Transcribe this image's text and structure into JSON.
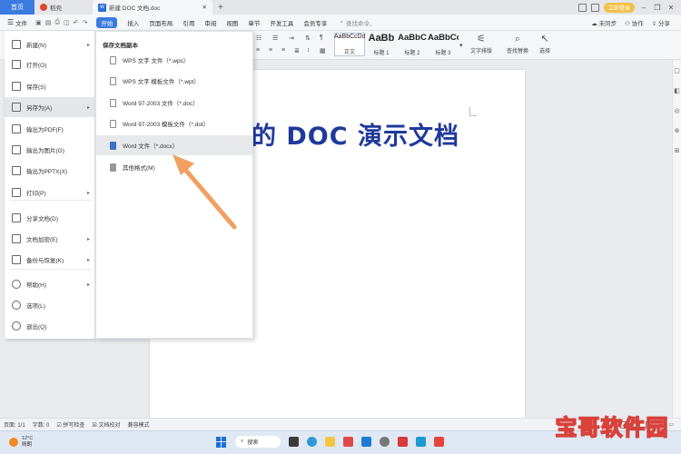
{
  "tabs": {
    "home": "首页",
    "dao": "稻壳",
    "doc_title": "新建 DOC 文档.doc",
    "login_label": "立即登录"
  },
  "menubar": {
    "file_label": "文件",
    "ribbon_tabs": [
      "开始",
      "插入",
      "页面布局",
      "引用",
      "审阅",
      "视图",
      "章节",
      "开发工具",
      "会员专享"
    ],
    "search_placeholder": "查找命令、",
    "unsync": "未同步",
    "collab": "协作",
    "share": "分享"
  },
  "toolbar": {
    "styles": [
      {
        "sample": "AaBbCcDd",
        "caption": "正文"
      },
      {
        "sample": "AaBb",
        "caption": "标题 1"
      },
      {
        "sample": "AaBbC",
        "caption": "标题 2"
      },
      {
        "sample": "AaBbCc",
        "caption": "标题 3"
      }
    ],
    "tools": [
      {
        "label": "文字排版",
        "icon": "text-layout-icon"
      },
      {
        "label": "查找替换",
        "icon": "find-replace-icon"
      },
      {
        "label": "选择",
        "icon": "select-cursor-icon"
      }
    ]
  },
  "file_menu": {
    "items": [
      {
        "label": "新建(N)",
        "icon": "new-doc-icon",
        "has_arrow": true
      },
      {
        "label": "打开(O)",
        "icon": "open-folder-icon",
        "has_arrow": false
      },
      {
        "label": "保存(S)",
        "icon": "save-icon",
        "has_arrow": false
      },
      {
        "label": "另存为(A)",
        "icon": "save-as-icon",
        "has_arrow": true
      },
      {
        "label": "输出为PDF(F)",
        "icon": "export-pdf-icon",
        "has_arrow": false
      },
      {
        "label": "输出为图片(G)",
        "icon": "export-image-icon",
        "has_arrow": false
      },
      {
        "label": "输出为PPTX(X)",
        "icon": "export-pptx-icon",
        "has_arrow": false
      },
      {
        "label": "打印(P)",
        "icon": "print-icon",
        "has_arrow": true
      },
      {
        "label": "分享文档(D)",
        "icon": "share-doc-icon",
        "has_arrow": false
      },
      {
        "label": "文档加密(E)",
        "icon": "encrypt-icon",
        "has_arrow": true
      },
      {
        "label": "备份与恢复(K)",
        "icon": "backup-icon",
        "has_arrow": true
      },
      {
        "label": "帮助(H)",
        "icon": "help-icon",
        "has_arrow": true
      },
      {
        "label": "选项(L)",
        "icon": "options-icon",
        "has_arrow": false
      },
      {
        "label": "退出(Q)",
        "icon": "exit-icon",
        "has_arrow": false
      }
    ]
  },
  "save_as_submenu": {
    "title": "保存文档副本",
    "items": [
      {
        "label": "WPS 文字 文件（*.wps）"
      },
      {
        "label": "WPS 文字 模板文件（*.wpt）"
      },
      {
        "label": "Word 97-2003 文件（*.doc）"
      },
      {
        "label": "Word 97-2003 模板文件（*.dot）"
      },
      {
        "label": "Word 文件（*.docx）"
      },
      {
        "label": "其他格式(M)"
      }
    ]
  },
  "document": {
    "heading_text": "的 DOC 演示文档"
  },
  "statusbar": {
    "page": "页面: 1/1",
    "words": "字数: 0",
    "spell": "拼写检查",
    "proof": "文档校对",
    "compat": "兼容模式"
  },
  "taskbar": {
    "temperature": "12°C",
    "weather": "晴朗",
    "search": "搜索"
  },
  "watermark": {
    "text": "宝哥软件园"
  },
  "colors": {
    "accent": "#3a7be0",
    "heading": "#1f3a9b",
    "arrow": "#f0a060"
  }
}
